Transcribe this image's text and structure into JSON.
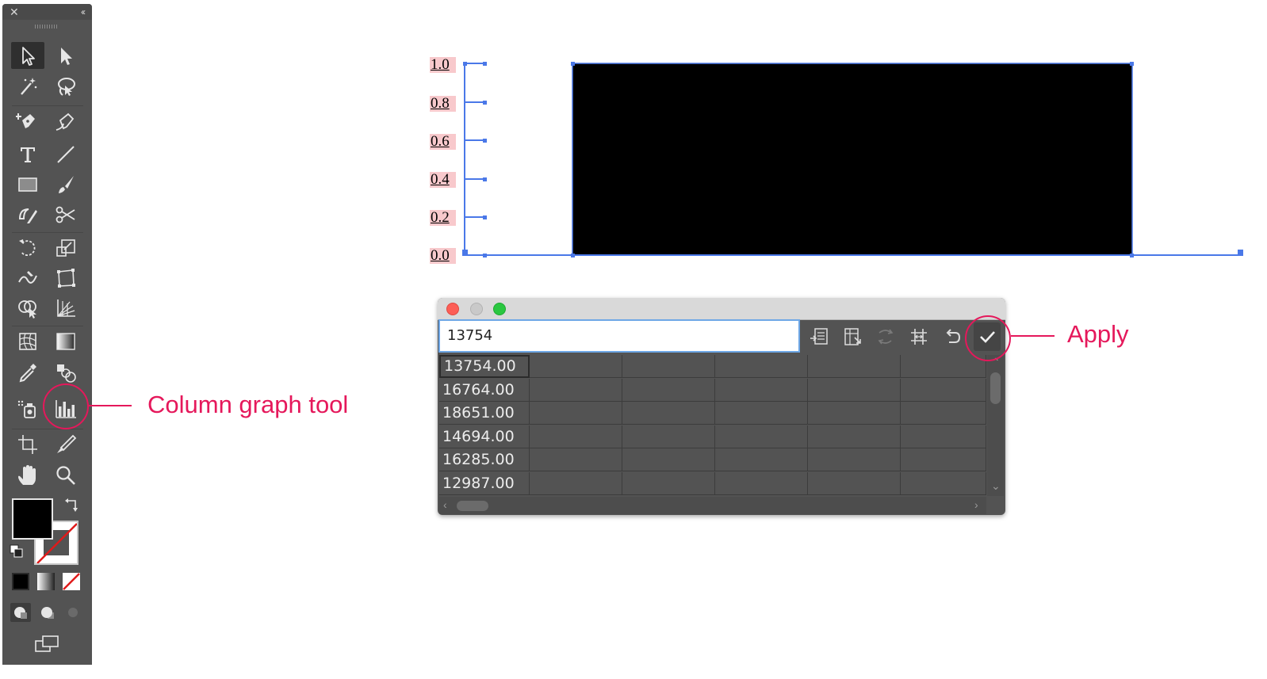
{
  "tools_panel": {
    "close_glyph": "✕",
    "collapse_glyph": "‹‹",
    "tools": [
      "selection-tool",
      "direct-selection-tool",
      "magic-wand-tool",
      "lasso-tool",
      "pen-tool",
      "curvature-tool",
      "type-tool",
      "line-segment-tool",
      "rectangle-tool",
      "paintbrush-tool",
      "shaper-tool",
      "scissors-tool",
      "rotate-tool",
      "scale-tool",
      "warp-tool",
      "free-transform-tool",
      "shape-builder-tool",
      "perspective-grid-tool",
      "mesh-tool",
      "gradient-tool",
      "eyedropper-tool",
      "blend-tool",
      "symbol-sprayer-tool",
      "column-graph-tool",
      "artboard-tool",
      "slice-tool",
      "hand-tool",
      "zoom-tool"
    ],
    "fill_color": "#000000",
    "stroke_color": "none"
  },
  "graph": {
    "y_ticks": [
      "1.0",
      "0.8",
      "0.6",
      "0.4",
      "0.2",
      "0.0"
    ],
    "bar_color": "#000000",
    "selection_color": "#4a78e8"
  },
  "graph_data_window": {
    "entry_value": "13754",
    "buttons": [
      "import-data",
      "transpose-row-column",
      "switch-x-y",
      "cell-style",
      "revert",
      "apply"
    ],
    "columns": 6,
    "rows": [
      [
        "13754.00",
        "",
        "",
        "",
        "",
        ""
      ],
      [
        "16764.00",
        "",
        "",
        "",
        "",
        ""
      ],
      [
        "18651.00",
        "",
        "",
        "",
        "",
        ""
      ],
      [
        "14694.00",
        "",
        "",
        "",
        "",
        ""
      ],
      [
        "16285.00",
        "",
        "",
        "",
        "",
        ""
      ],
      [
        "12987.00",
        "",
        "",
        "",
        "",
        ""
      ]
    ]
  },
  "annotations": {
    "column_graph_tool": "Column graph tool",
    "apply": "Apply",
    "color": "#e5185b"
  }
}
